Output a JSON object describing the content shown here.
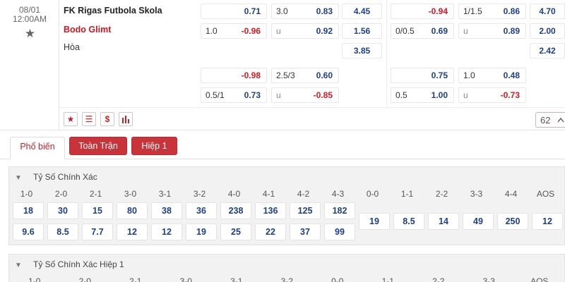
{
  "match": {
    "date": "08/01",
    "time": "12:00AM",
    "home_team": "FK Rigas Futbola Skola",
    "away_team": "Bodo Glimt",
    "draw_label": "Hòa",
    "odds_cells": [
      {
        "id": "ft-hdp-home",
        "label": "",
        "value": "0.71",
        "neg": false
      },
      {
        "id": "ft-ou-over",
        "label": "3.0",
        "value": "0.83",
        "neg": false
      },
      {
        "id": "ft-1x2-home",
        "label": "",
        "value": "4.45",
        "neg": false
      },
      {
        "id": "h1-hdp-home",
        "label": "",
        "value": "-0.94",
        "neg": true
      },
      {
        "id": "h1-ou-over",
        "label": "1/1.5",
        "value": "0.86",
        "neg": false
      },
      {
        "id": "h1-1x2-home",
        "label": "",
        "value": "4.70",
        "neg": false
      },
      {
        "id": "ft-hdp-away",
        "label": "1.0",
        "value": "-0.96",
        "neg": true
      },
      {
        "id": "ft-ou-under",
        "label": "u",
        "value": "0.92",
        "neg": false
      },
      {
        "id": "ft-1x2-away",
        "label": "",
        "value": "1.56",
        "neg": false
      },
      {
        "id": "h1-hdp-away",
        "label": "0/0.5",
        "value": "0.69",
        "neg": false
      },
      {
        "id": "h1-ou-under",
        "label": "u",
        "value": "0.89",
        "neg": false
      },
      {
        "id": "h1-1x2-away",
        "label": "",
        "value": "2.00",
        "neg": false
      },
      {
        "id": "ft-1x2-draw",
        "label": "",
        "value": "3.85",
        "neg": false
      },
      {
        "id": "h1-1x2-draw",
        "label": "",
        "value": "2.42",
        "neg": false
      },
      {
        "id": "ft-hdp2-home",
        "label": "",
        "value": "-0.98",
        "neg": true
      },
      {
        "id": "ft-ou2-over",
        "label": "2.5/3",
        "value": "0.60",
        "neg": false
      },
      {
        "id": "h1-hdp2-home",
        "label": "",
        "value": "0.75",
        "neg": false
      },
      {
        "id": "h1-ou2-over",
        "label": "1.0",
        "value": "0.48",
        "neg": false
      },
      {
        "id": "ft-hdp2-away",
        "label": "0.5/1",
        "value": "0.73",
        "neg": false
      },
      {
        "id": "ft-ou2-under",
        "label": "u",
        "value": "-0.85",
        "neg": true
      },
      {
        "id": "h1-hdp2-away",
        "label": "0.5",
        "value": "1.00",
        "neg": false
      },
      {
        "id": "h1-ou2-under",
        "label": "u",
        "value": "-0.73",
        "neg": true
      }
    ],
    "icons": [
      "star-icon",
      "list-icon",
      "dollar-icon",
      "bar-chart-icon"
    ],
    "more_count": "62",
    "more_chevron": "^"
  },
  "tabs": [
    "Phổ biến",
    "Toàn Trận",
    "Hiệp 1"
  ],
  "correct_score": {
    "title": "Tỷ Số Chính Xác",
    "headers": [
      "1-0",
      "2-0",
      "2-1",
      "3-0",
      "3-1",
      "3-2",
      "4-0",
      "4-1",
      "4-2",
      "4-3",
      "0-0",
      "1-1",
      "2-2",
      "3-3",
      "4-4",
      "AOS"
    ],
    "row_home": [
      "18",
      "30",
      "15",
      "80",
      "38",
      "36",
      "238",
      "136",
      "125",
      "182"
    ],
    "row_away": [
      "9.6",
      "8.5",
      "7.7",
      "12",
      "12",
      "19",
      "25",
      "22",
      "37",
      "99"
    ],
    "row_draw": [
      "19",
      "8.5",
      "14",
      "49",
      "250",
      "12"
    ]
  },
  "correct_score_h1": {
    "title": "Tỷ Số Chính Xác Hiệp 1",
    "headers": [
      "1-0",
      "2-0",
      "2-1",
      "3-0",
      "3-1",
      "3-2",
      "0-0",
      "1-1",
      "2-2",
      "3-3",
      "AOS"
    ]
  },
  "colors": {
    "accent_red": "#cc1f2a",
    "odds_blue": "#1c3e8c",
    "negative_red": "#e1141c"
  }
}
